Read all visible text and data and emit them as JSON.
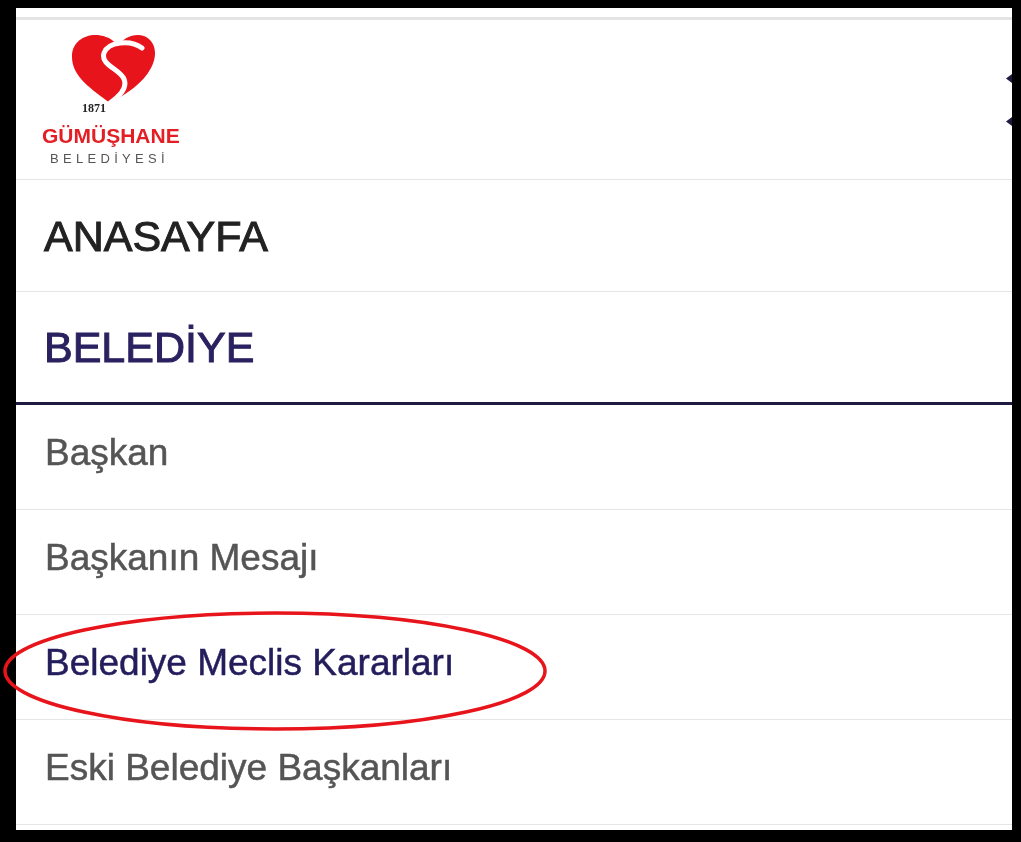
{
  "logo": {
    "year": "1871",
    "name": "GÜMÜŞHANE",
    "subtitle": "BELEDİYESİ"
  },
  "menu": [
    {
      "label": "ANASAYFA",
      "expanded": false
    },
    {
      "label": "BELEDİYE",
      "expanded": true,
      "children": [
        {
          "label": "Başkan",
          "selected": false,
          "circled": false
        },
        {
          "label": "Başkanın Mesajı",
          "selected": false,
          "circled": false
        },
        {
          "label": "Belediye Meclis Kararları",
          "selected": true,
          "circled": true
        },
        {
          "label": "Eski Belediye Başkanları",
          "selected": false,
          "circled": false
        }
      ]
    }
  ]
}
